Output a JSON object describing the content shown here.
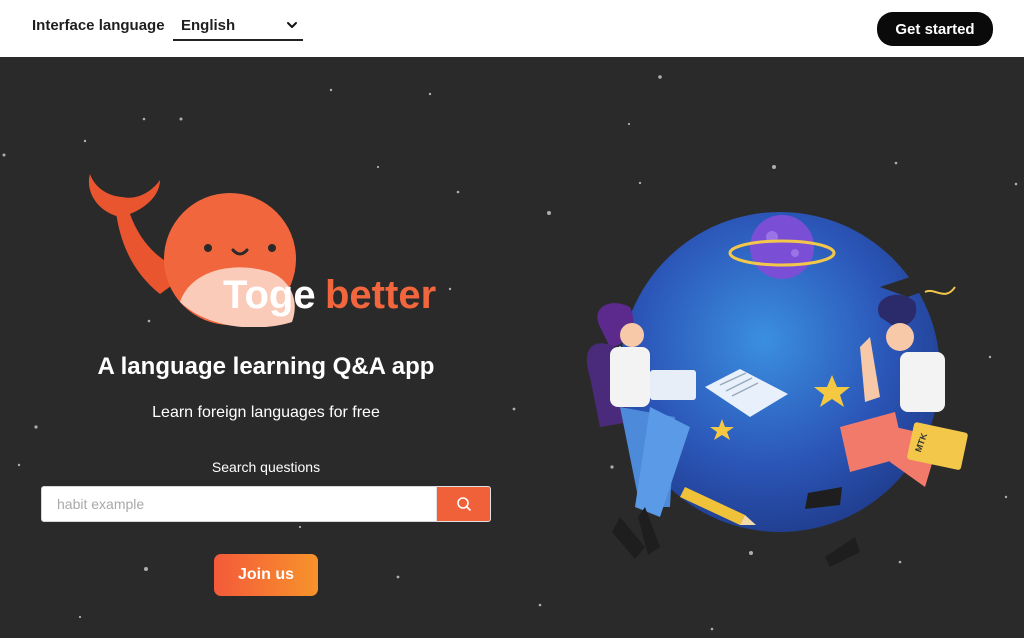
{
  "header": {
    "language_label": "Interface language",
    "language_value": "English",
    "get_started": "Get started"
  },
  "hero": {
    "brand_name_part1": "Toge",
    "brand_name_part2": "better",
    "tagline": "A language learning Q&A app",
    "subtitle": "Learn foreign languages for free",
    "search_label": "Search questions",
    "search_placeholder": "habit example",
    "join_button": "Join us",
    "book_label": "MTK"
  },
  "colors": {
    "accent": "#f0613a",
    "brand_orange": "#f2663d",
    "background": "#2a2a2a",
    "topbar": "#ffffff"
  },
  "icons": [
    "chevron-down-icon",
    "search-icon",
    "whale-logo-icon"
  ]
}
